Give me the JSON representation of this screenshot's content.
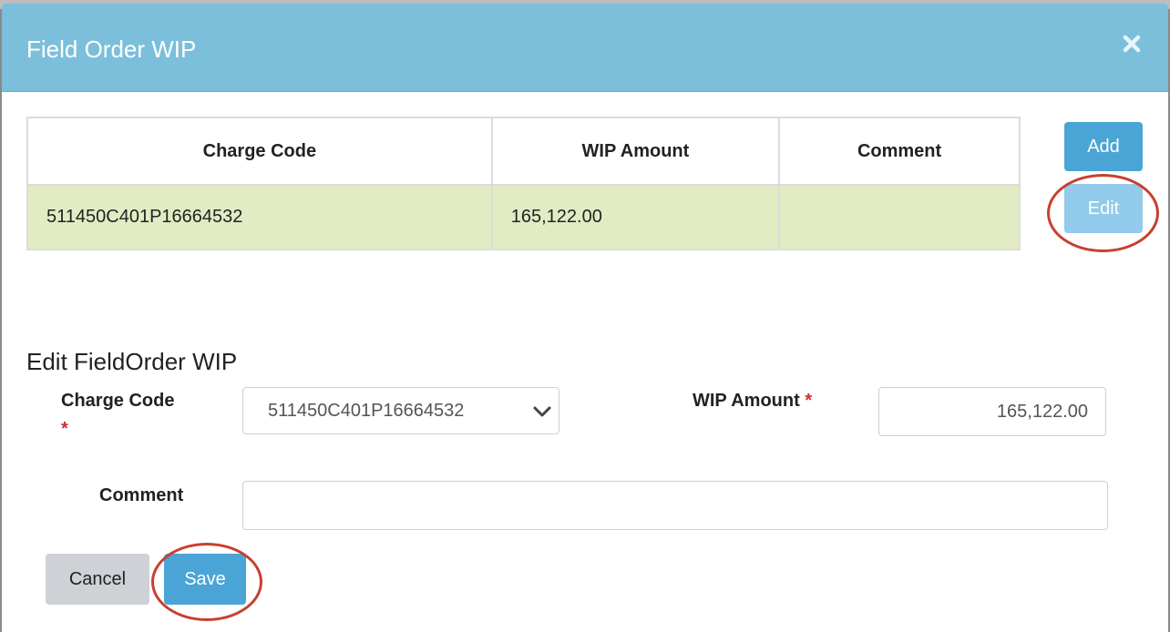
{
  "modal": {
    "title": "Field Order WIP",
    "close_icon": "close-icon"
  },
  "table": {
    "columns": [
      "Charge Code",
      "WIP Amount",
      "Comment"
    ],
    "rows": [
      {
        "charge_code": "511450C401P16664532",
        "wip_amount": "165,122.00",
        "comment": ""
      }
    ]
  },
  "actions": {
    "add_label": "Add",
    "edit_label": "Edit"
  },
  "form": {
    "section_title": "Edit FieldOrder WIP",
    "charge_code_label": "Charge Code",
    "charge_code_value": "511450C401P16664532",
    "wip_amount_label": "WIP Amount",
    "wip_amount_value": "165,122.00",
    "comment_label": "Comment",
    "comment_value": "",
    "required_marker": "*",
    "cancel_label": "Cancel",
    "save_label": "Save"
  },
  "colors": {
    "header": "#7bbfdb",
    "primary_button": "#4aa5d6",
    "selected_row": "#e2ecc4",
    "annotation": "#c8402e"
  }
}
